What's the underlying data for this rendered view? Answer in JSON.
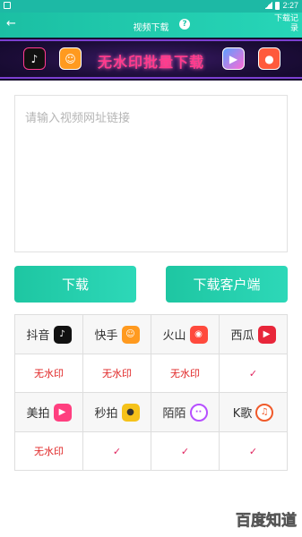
{
  "status_bar": {
    "time": "2:27",
    "notification_icon": "square-notification-icon",
    "signal_icon": "signal-icon",
    "battery_icon": "battery-icon"
  },
  "app_bar": {
    "back_icon": "arrow-left-icon",
    "title": "视频下载",
    "help_icon": "question-circle-icon",
    "history_label": "下载记录"
  },
  "banner": {
    "text": "无水印批量下载",
    "left_icons": [
      "douyin-icon",
      "user-app-icon"
    ],
    "right_icons": [
      "video-app-icon",
      "kuaishou-style-icon"
    ]
  },
  "url_input": {
    "value": "",
    "placeholder": "请输入视频网址链接"
  },
  "buttons": {
    "download": "下载",
    "download_client": "下载客户端"
  },
  "platforms": {
    "rows": [
      {
        "names": [
          {
            "name": "抖音",
            "icon": "douyin-icon",
            "color": "#111111"
          },
          {
            "name": "快手",
            "icon": "kuaishou-icon",
            "color": "#ff9a1f"
          },
          {
            "name": "火山",
            "icon": "huoshan-icon",
            "color": "#ff4a3d"
          },
          {
            "name": "西瓜",
            "icon": "xigua-icon",
            "color": "#e8263a"
          }
        ],
        "status": [
          "无水印",
          "无水印",
          "无水印",
          "✓"
        ]
      },
      {
        "names": [
          {
            "name": "美拍",
            "icon": "meipai-icon",
            "color": "#ff3f7f"
          },
          {
            "name": "秒拍",
            "icon": "miaopai-icon",
            "color": "#f5c21a"
          },
          {
            "name": "陌陌",
            "icon": "momo-icon",
            "color": "#b64fff"
          },
          {
            "name": "K歌",
            "icon": "kge-icon",
            "color": "#f05a2a"
          }
        ],
        "status": [
          "无水印",
          "✓",
          "✓",
          "✓"
        ]
      }
    ]
  },
  "watermark": "百度知道",
  "colors": {
    "accent": "#1ec6a2",
    "banner_text": "#ff3b8d",
    "status_red": "#e02424",
    "check": "#e0245e"
  }
}
